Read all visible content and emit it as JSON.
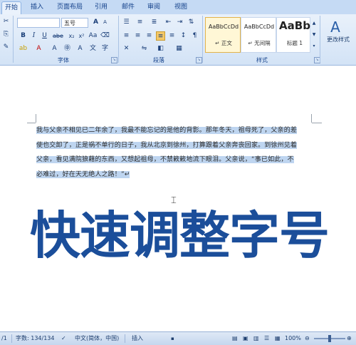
{
  "ribbon_tabs": [
    "开始",
    "插入",
    "页面布局",
    "引用",
    "邮件",
    "审阅",
    "视图"
  ],
  "font": {
    "name_value": "",
    "size_value": "五号",
    "group_label": "字体"
  },
  "paragraph": {
    "group_label": "段落"
  },
  "styles": {
    "group_label": "样式",
    "items": [
      {
        "sample": "AaBbCcDd",
        "name": "↵ 正文"
      },
      {
        "sample": "AaBbCcDd",
        "name": "↵ 无间隔"
      },
      {
        "sample": "AaBb",
        "name": "标题 1"
      }
    ],
    "change_styles_label": "更改样式"
  },
  "document": {
    "paragraph_lines": [
      "我与父亲不相见已二年余了，我最不能忘记的是他的背影。那年冬天，祖母死了，父亲的差",
      "使也交卸了，正是祸不单行的日子，我从北京到徐州，打算跟着父亲奔丧回家。到徐州见着",
      "父亲，看见满院狼藉的东西，又想起祖母，不禁簌簌地流下眼泪。父亲说，“事已如此，不",
      "必难过，好在天无绝人之路！”↵"
    ],
    "overlay_title": "快速调整字号"
  },
  "status_bar": {
    "page_fragment": "/1",
    "word_count": "字数: 134/134",
    "language": "中文(简体，中国)",
    "insert_mode": "插入",
    "zoom": "100%"
  },
  "colors": {
    "accent": "#1b4e9a",
    "ribbon": "#d3e3f6",
    "highlight": "#bed5f0"
  }
}
